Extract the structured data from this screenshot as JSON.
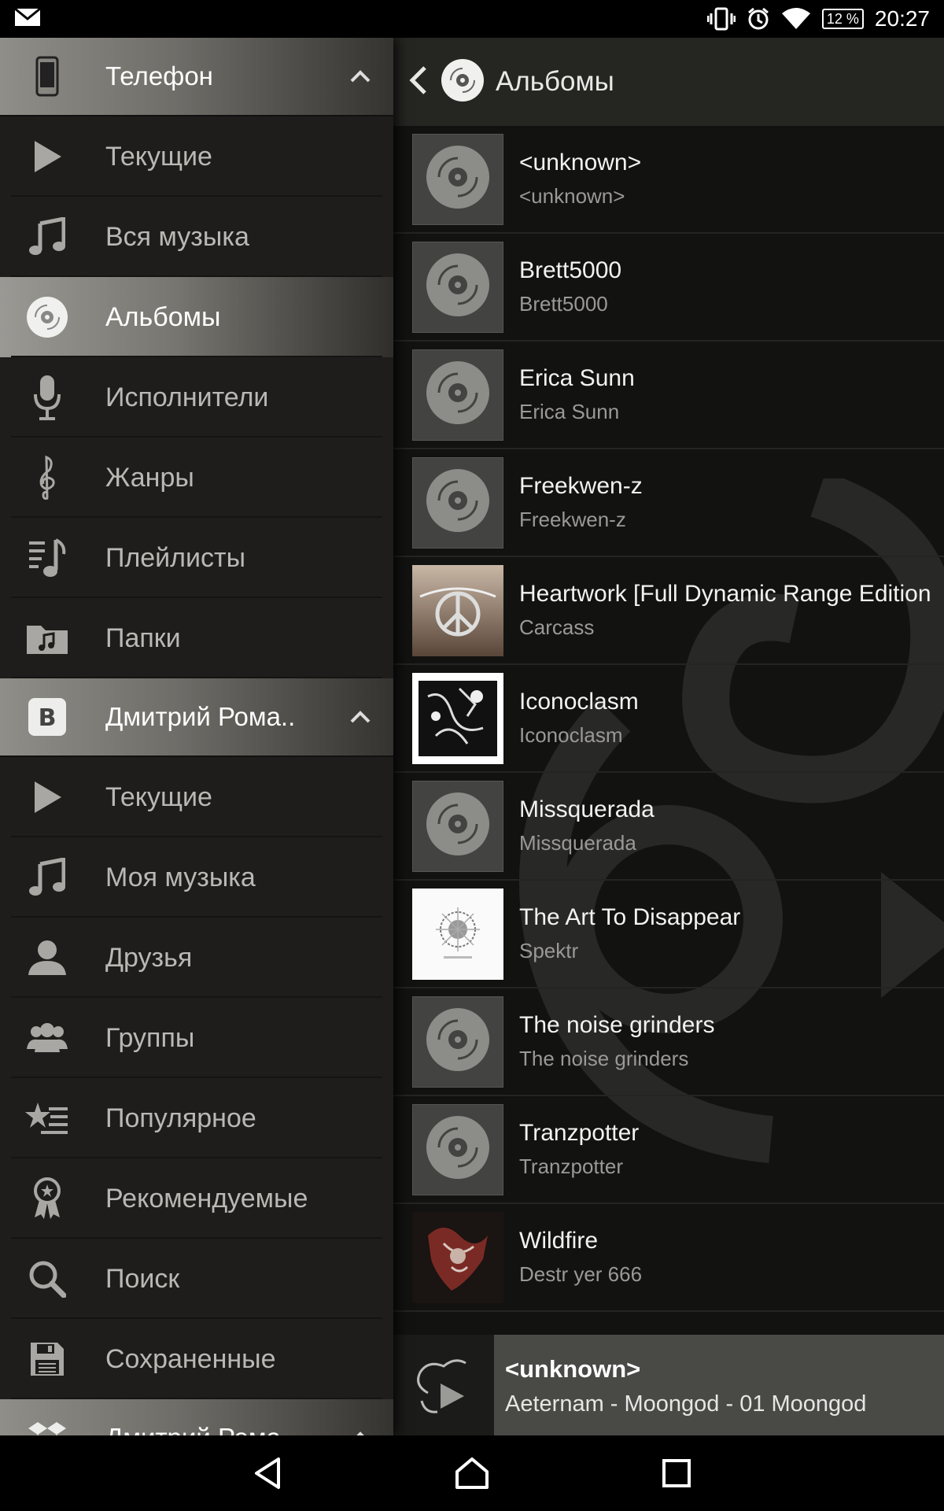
{
  "status": {
    "time": "20:27",
    "battery": "12 %"
  },
  "drawer": {
    "sections": [
      {
        "title": "Телефон",
        "icon": "phone-icon",
        "items": [
          {
            "label": "Текущие",
            "icon": "play-icon"
          },
          {
            "label": "Вся музыка",
            "icon": "music-note-icon"
          },
          {
            "label": "Альбомы",
            "icon": "disc-icon",
            "active": true
          },
          {
            "label": "Исполнители",
            "icon": "microphone-icon"
          },
          {
            "label": "Жанры",
            "icon": "treble-clef-icon"
          },
          {
            "label": "Плейлисты",
            "icon": "playlist-icon"
          },
          {
            "label": "Папки",
            "icon": "folder-music-icon"
          }
        ]
      },
      {
        "title": "Дмитрий Рома..",
        "icon": "vk-icon",
        "items": [
          {
            "label": "Текущие",
            "icon": "play-icon"
          },
          {
            "label": "Моя музыка",
            "icon": "music-note-icon"
          },
          {
            "label": "Друзья",
            "icon": "person-icon"
          },
          {
            "label": "Группы",
            "icon": "group-icon"
          },
          {
            "label": "Популярное",
            "icon": "star-list-icon"
          },
          {
            "label": "Рекомендуемые",
            "icon": "award-icon"
          },
          {
            "label": "Поиск",
            "icon": "search-icon"
          },
          {
            "label": "Сохраненные",
            "icon": "save-icon"
          }
        ]
      },
      {
        "title": "Дмитрий Рома..",
        "icon": "dropbox-icon"
      }
    ]
  },
  "toolbar": {
    "title": "Альбомы"
  },
  "albums": [
    {
      "title": "<unknown>",
      "artist": "<unknown>",
      "art": "placeholder"
    },
    {
      "title": "Brett5000",
      "artist": "Brett5000",
      "art": "placeholder"
    },
    {
      "title": "Erica Sunn",
      "artist": "Erica Sunn",
      "art": "placeholder"
    },
    {
      "title": "Freekwen-z",
      "artist": "Freekwen-z",
      "art": "placeholder"
    },
    {
      "title": "Heartwork [Full Dynamic Range Edition",
      "artist": "Carcass",
      "art": "heartwork"
    },
    {
      "title": "Iconoclasm",
      "artist": "Iconoclasm",
      "art": "iconoclasm"
    },
    {
      "title": "Missquerada",
      "artist": "Missquerada",
      "art": "placeholder"
    },
    {
      "title": "The Art To Disappear",
      "artist": "Spektr",
      "art": "spektr"
    },
    {
      "title": "The noise grinders",
      "artist": "The noise grinders",
      "art": "placeholder"
    },
    {
      "title": "Tranzpotter",
      "artist": "Tranzpotter",
      "art": "placeholder"
    },
    {
      "title": "Wildfire",
      "artist": "Destr yer 666",
      "art": "wildfire"
    }
  ],
  "now_playing": {
    "title": "<unknown>",
    "subtitle": "Aeternam - Moongod - 01 Moongod"
  },
  "colors": {
    "drawer_bg": "#1e1d1b",
    "content_bg": "#121211",
    "accent_active": "#8f8e88"
  }
}
